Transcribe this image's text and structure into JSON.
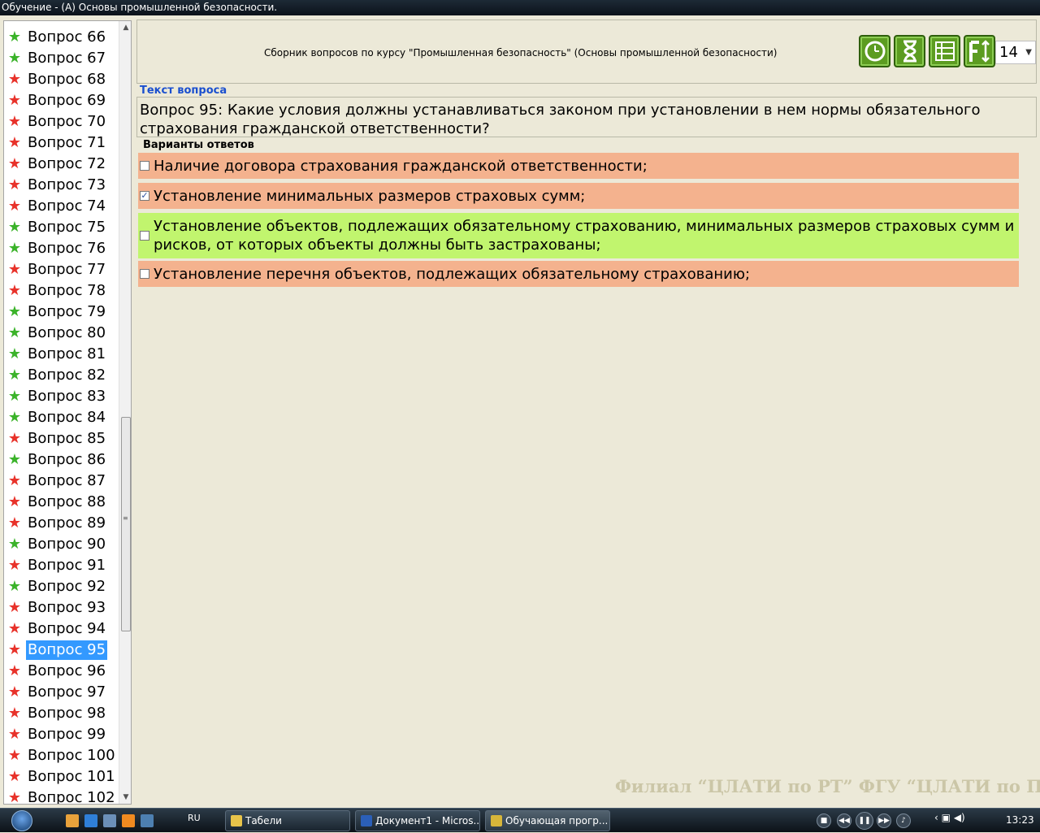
{
  "window": {
    "title": "Обучение - (А) Основы промышленной безопасности."
  },
  "sidebar": {
    "items": [
      {
        "label": "Вопрос 66",
        "status": "green"
      },
      {
        "label": "Вопрос 67",
        "status": "green"
      },
      {
        "label": "Вопрос 68",
        "status": "red"
      },
      {
        "label": "Вопрос 69",
        "status": "red"
      },
      {
        "label": "Вопрос 70",
        "status": "red"
      },
      {
        "label": "Вопрос 71",
        "status": "red"
      },
      {
        "label": "Вопрос 72",
        "status": "red"
      },
      {
        "label": "Вопрос 73",
        "status": "red"
      },
      {
        "label": "Вопрос 74",
        "status": "red"
      },
      {
        "label": "Вопрос 75",
        "status": "green"
      },
      {
        "label": "Вопрос 76",
        "status": "green"
      },
      {
        "label": "Вопрос 77",
        "status": "red"
      },
      {
        "label": "Вопрос 78",
        "status": "red"
      },
      {
        "label": "Вопрос 79",
        "status": "green"
      },
      {
        "label": "Вопрос 80",
        "status": "green"
      },
      {
        "label": "Вопрос 81",
        "status": "green"
      },
      {
        "label": "Вопрос 82",
        "status": "green"
      },
      {
        "label": "Вопрос 83",
        "status": "green"
      },
      {
        "label": "Вопрос 84",
        "status": "green"
      },
      {
        "label": "Вопрос 85",
        "status": "red"
      },
      {
        "label": "Вопрос 86",
        "status": "green"
      },
      {
        "label": "Вопрос 87",
        "status": "red"
      },
      {
        "label": "Вопрос 88",
        "status": "red"
      },
      {
        "label": "Вопрос 89",
        "status": "red"
      },
      {
        "label": "Вопрос 90",
        "status": "green"
      },
      {
        "label": "Вопрос 91",
        "status": "red"
      },
      {
        "label": "Вопрос 92",
        "status": "green"
      },
      {
        "label": "Вопрос 93",
        "status": "red"
      },
      {
        "label": "Вопрос 94",
        "status": "red"
      },
      {
        "label": "Вопрос 95",
        "status": "red",
        "selected": true
      },
      {
        "label": "Вопрос 96",
        "status": "red"
      },
      {
        "label": "Вопрос 97",
        "status": "red"
      },
      {
        "label": "Вопрос 98",
        "status": "red"
      },
      {
        "label": "Вопрос 99",
        "status": "red"
      },
      {
        "label": "Вопрос 100",
        "status": "red"
      },
      {
        "label": "Вопрос 101",
        "status": "red"
      },
      {
        "label": "Вопрос 102",
        "status": "red"
      }
    ]
  },
  "header": {
    "collection_title": "Сборник вопросов по курсу \"Промышленная безопасность\" (Основы промышленной безопасности)",
    "toolbar_icons": [
      "clock-icon",
      "hourglass-icon",
      "list-icon",
      "font-size-icon"
    ],
    "font_size_value": "14"
  },
  "question": {
    "section_label": "Текст вопроса",
    "text": "Вопрос 95: Какие условия должны устанавливаться законом при установлении в нем нормы обязательного страхования гражданской ответственности?"
  },
  "answers": {
    "section_label": "Варианты ответов",
    "items": [
      {
        "text": "Наличие договора страхования гражданской ответственности;",
        "checked": false,
        "color": "#f4b28e"
      },
      {
        "text": "Установление минимальных размеров страховых сумм;",
        "checked": true,
        "color": "#f4b28e"
      },
      {
        "text": "Установление объектов, подлежащих обязательному страхованию, минимальных размеров страховых сумм и рисков, от которых объекты должны быть застрахованы;",
        "checked": false,
        "color": "#c1f56e"
      },
      {
        "text": "Установление перечня объектов, подлежащих обязательному страхованию;",
        "checked": false,
        "color": "#f4b28e"
      }
    ]
  },
  "watermark": "Филиал “ЦЛАТИ по РТ” ФГУ “ЦЛАТИ по ПФО”",
  "colors": {
    "star_green": "#3bb32a",
    "star_red": "#e8322a",
    "selection": "#3399ff"
  },
  "taskbar": {
    "language": "RU",
    "tasks": [
      {
        "label": "Табели"
      },
      {
        "label": "Документ1 - Micros..."
      },
      {
        "label": "Обучающая прогр..."
      }
    ],
    "clock": "13:23"
  }
}
